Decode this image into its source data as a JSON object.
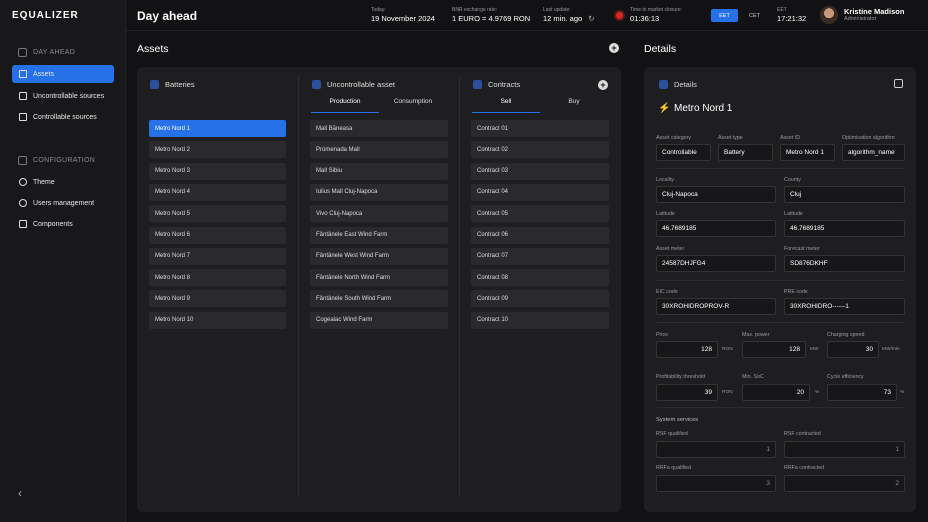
{
  "app": {
    "logo": "EQUALIZER"
  },
  "sidebar": {
    "day_ahead_section": "DAY AHEAD",
    "items": [
      {
        "label": "Assets"
      },
      {
        "label": "Uncontrollable sources"
      },
      {
        "label": "Controllable sources"
      }
    ],
    "config_section": "CONFIGURATION",
    "config_items": [
      {
        "label": "Theme"
      },
      {
        "label": "Users management"
      },
      {
        "label": "Components"
      }
    ],
    "collapse": "‹"
  },
  "topbar": {
    "title": "Day ahead",
    "today_label": "Today:",
    "today_value": "19 November 2024",
    "bnr_label": "BNR exchange rate:",
    "bnr_value": "1 EURO = 4.9769 RON",
    "update_label": "Last update:",
    "update_value": "12 min. ago",
    "closure_label": "Time to market closure:",
    "closure_value": "01:36:13",
    "tz_options": [
      "EET",
      "CET"
    ],
    "eet_label": "EET",
    "eet_time": "17:21:32",
    "user_name": "Kristine Madison",
    "user_role": "Administrator"
  },
  "assets": {
    "header": "Assets",
    "batteries": {
      "title": "Batteries",
      "items": [
        "Metro Nord 1",
        "Metro Nord 2",
        "Metro Nord 3",
        "Metro Nord 4",
        "Metro Nord 5",
        "Metro Nord 6",
        "Metro Nord 7",
        "Metro Nord 8",
        "Metro Nord 9",
        "Metro Nord 10"
      ]
    },
    "uncontrollable": {
      "title": "Uncontrollable asset",
      "tabs": [
        "Production",
        "Consumption"
      ],
      "items": [
        "Mall Băneasa",
        "Promenada Mall",
        "Mall Sibiu",
        "Iulius Mall Cluj-Napoca",
        "Vivo Cluj-Napoca",
        "Fântânele East Wind Farm",
        "Fântânele West Wind Farm",
        "Fântânele North Wind Farm",
        "Fântânele South Wind Farm",
        "Cogealac Wind Farm"
      ]
    },
    "contracts": {
      "title": "Contracts",
      "tabs": [
        "Sell",
        "Buy"
      ],
      "items": [
        "Contract 01",
        "Contract 02",
        "Contract 03",
        "Contract 04",
        "Contract 05",
        "Contract 06",
        "Contract 07",
        "Contract 08",
        "Contract 09",
        "Contract 10"
      ]
    }
  },
  "details": {
    "header": "Details",
    "panel_title": "Details",
    "asset_name": "Metro Nord 1",
    "asset_category_label": "Asset category",
    "asset_category": "Controllable",
    "asset_type_label": "Asset type",
    "asset_type": "Battery",
    "asset_id_label": "Asset ID",
    "asset_id": "Metro Nord 1",
    "algorithm_label": "Optimisation algorithm",
    "algorithm": "algorithm_name",
    "locality_label": "Locality",
    "locality": "Cluj-Napoca",
    "county_label": "County",
    "county": "Cluj",
    "latitude_label": "Latitude",
    "latitude": "46.7689185",
    "latitude2_label": "Latitude",
    "latitude2": "46.7689185",
    "asset_meter_label": "Asset meter",
    "asset_meter": "24587DHJFG4",
    "forecast_meter_label": "Forecast meter",
    "forecast_meter": "SD876DKHF",
    "eic_label": "EIC code",
    "eic": "30XROHIDROPROV-R",
    "pre_label": "PRE code",
    "pre": "30XROHIDRO------1",
    "price_label": "Price",
    "price": "128",
    "price_unit": "RON",
    "maxpower_label": "Max. power",
    "maxpower": "128",
    "maxpower_unit": "MW",
    "charging_label": "Charging speed",
    "charging": "30",
    "charging_unit": "MW/min",
    "profit_label": "Profitability threshold",
    "profit": "39",
    "profit_unit": "RON",
    "minsoc_label": "Min. SoC",
    "minsoc": "20",
    "minsoc_unit": "%",
    "cycle_label": "Cycle efficiency",
    "cycle": "73",
    "cycle_unit": "%",
    "system_services": "System services",
    "rsf_q_label": "RSF qualified",
    "rsf_q": "1",
    "rsf_c_label": "RSF contracted",
    "rsf_c": "1",
    "rrfa_q_label": "RRFa qualified",
    "rrfa_q": "3",
    "rrfa_c_label": "RRFa contracted",
    "rrfa_c": "2"
  }
}
